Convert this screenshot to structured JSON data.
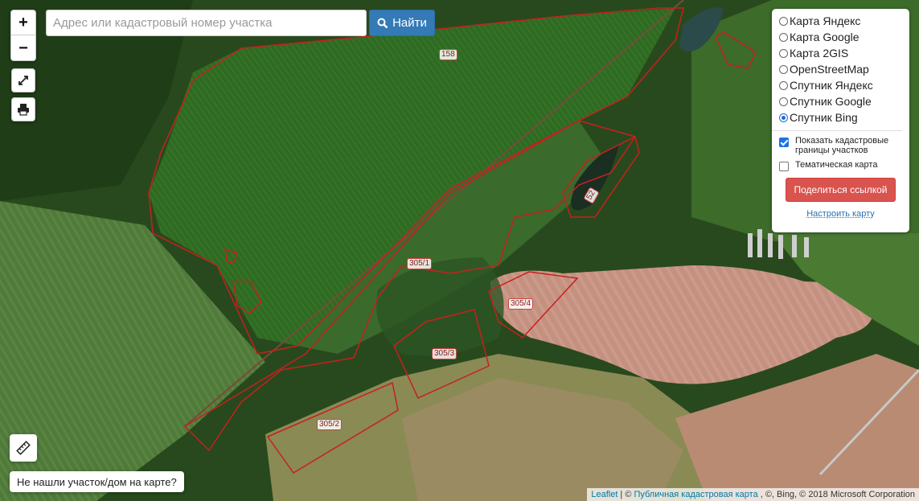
{
  "search": {
    "placeholder": "Адрес или кадастровый номер участка",
    "button_label": "Найти"
  },
  "zoom": {
    "in_label": "+",
    "out_label": "−"
  },
  "layers": {
    "options": [
      {
        "label": "Карта Яндекс",
        "selected": false
      },
      {
        "label": "Карта Google",
        "selected": false
      },
      {
        "label": "Карта 2GIS",
        "selected": false
      },
      {
        "label": "OpenStreetMap",
        "selected": false
      },
      {
        "label": "Спутник Яндекс",
        "selected": false
      },
      {
        "label": "Спутник Google",
        "selected": false
      },
      {
        "label": "Спутник Bing",
        "selected": true
      }
    ],
    "show_cadastral": {
      "label": "Показать кадастровые границы участков",
      "checked": true
    },
    "thematic": {
      "label": "Тематическая карта",
      "checked": false
    },
    "share_label": "Поделиться ссылкой",
    "setup_label": "Настроить карту"
  },
  "not_found_label": "Не нашли участок/дом на карте?",
  "attribution": {
    "leaflet": "Leaflet",
    "sep1": "| ©",
    "pkk": "Публичная кадастровая карта",
    "rest": ", ©, Bing, © 2018 Microsoft Corporation"
  },
  "parcels": [
    "158",
    "305/1",
    "305/4",
    "305/3",
    "305/2",
    "52"
  ],
  "colors": {
    "parcel_stroke": "#c8201e",
    "find_button": "#337ab7",
    "share_button": "#d9534f"
  },
  "icons": [
    "fullscreen-icon",
    "print-icon",
    "ruler-icon",
    "search-icon"
  ]
}
